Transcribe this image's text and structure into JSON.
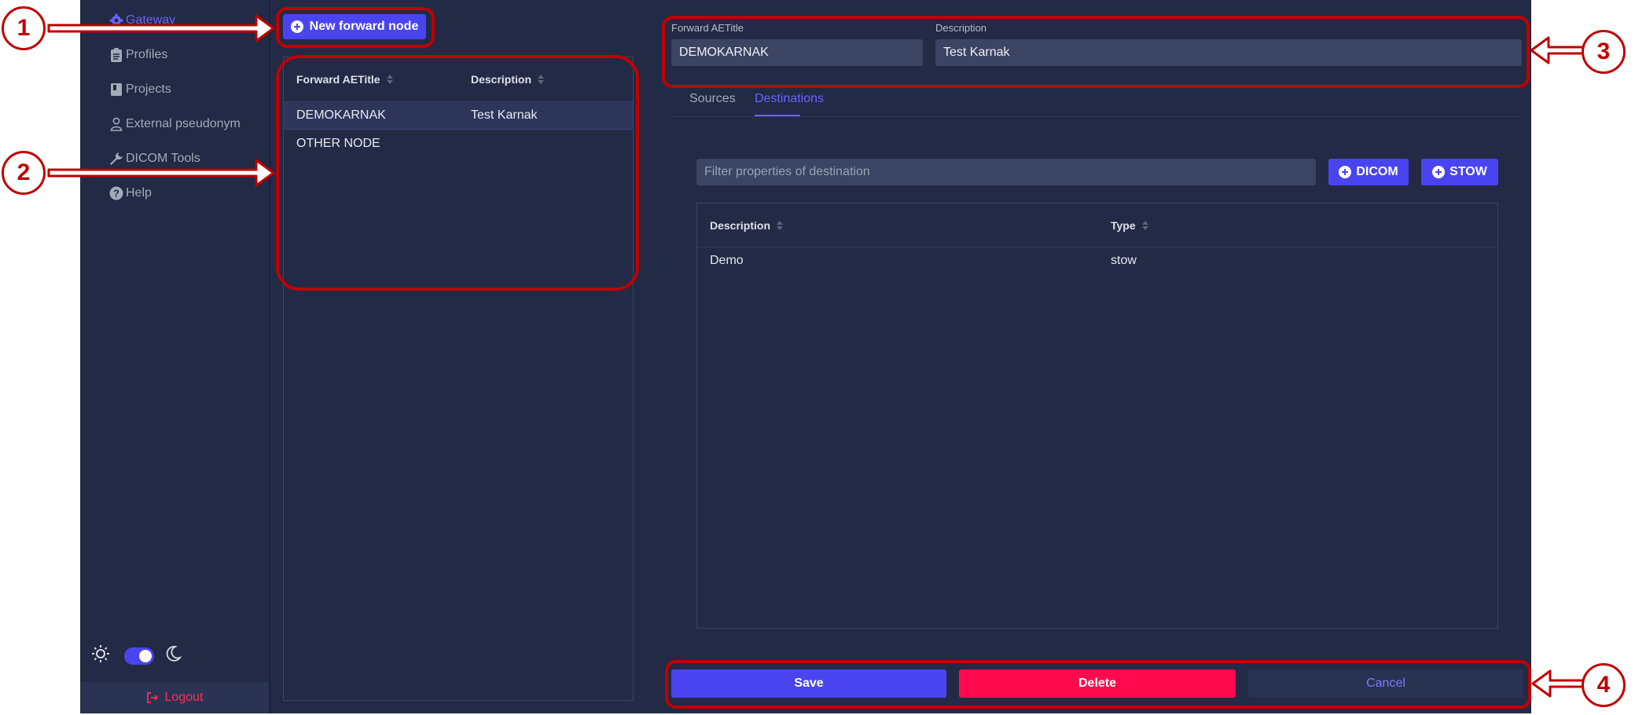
{
  "sidebar": {
    "items": [
      {
        "label": "Gateway",
        "icon": "gear-icon",
        "active": true
      },
      {
        "label": "Profiles",
        "icon": "clipboard-icon"
      },
      {
        "label": "Projects",
        "icon": "book-icon"
      },
      {
        "label": "External pseudonym",
        "icon": "user-icon"
      },
      {
        "label": "DICOM Tools",
        "icon": "wrench-icon"
      },
      {
        "label": "Help",
        "icon": "help-icon"
      }
    ],
    "logout_label": "Logout",
    "theme": {
      "light_icon": "sun-icon",
      "dark_icon": "moon-icon",
      "dark_mode_on": true
    }
  },
  "nodes": {
    "new_button_label": "New forward node",
    "columns": [
      "Forward AETitle",
      "Description"
    ],
    "rows": [
      {
        "aetitle": "DEMOKARNAK",
        "description": "Test Karnak",
        "selected": true
      },
      {
        "aetitle": "OTHER NODE",
        "description": ""
      }
    ]
  },
  "detail": {
    "aetitle_label": "Forward AETitle",
    "aetitle_value": "DEMOKARNAK",
    "description_label": "Description",
    "description_value": "Test Karnak",
    "tabs": [
      {
        "label": "Sources",
        "active": false
      },
      {
        "label": "Destinations",
        "active": true
      }
    ],
    "filter_placeholder": "Filter properties of destination",
    "add_dicom_label": "DICOM",
    "add_stow_label": "STOW",
    "destinations": {
      "columns": [
        "Description",
        "Type"
      ],
      "rows": [
        {
          "description": "Demo",
          "type": "stow"
        }
      ]
    }
  },
  "footer": {
    "save_label": "Save",
    "delete_label": "Delete",
    "cancel_label": "Cancel"
  },
  "callouts": [
    "1",
    "2",
    "3",
    "4"
  ],
  "colors": {
    "background": "#222a45",
    "accent": "#4a44f0",
    "danger": "#ff0a4e",
    "annotation": "#c00000"
  }
}
